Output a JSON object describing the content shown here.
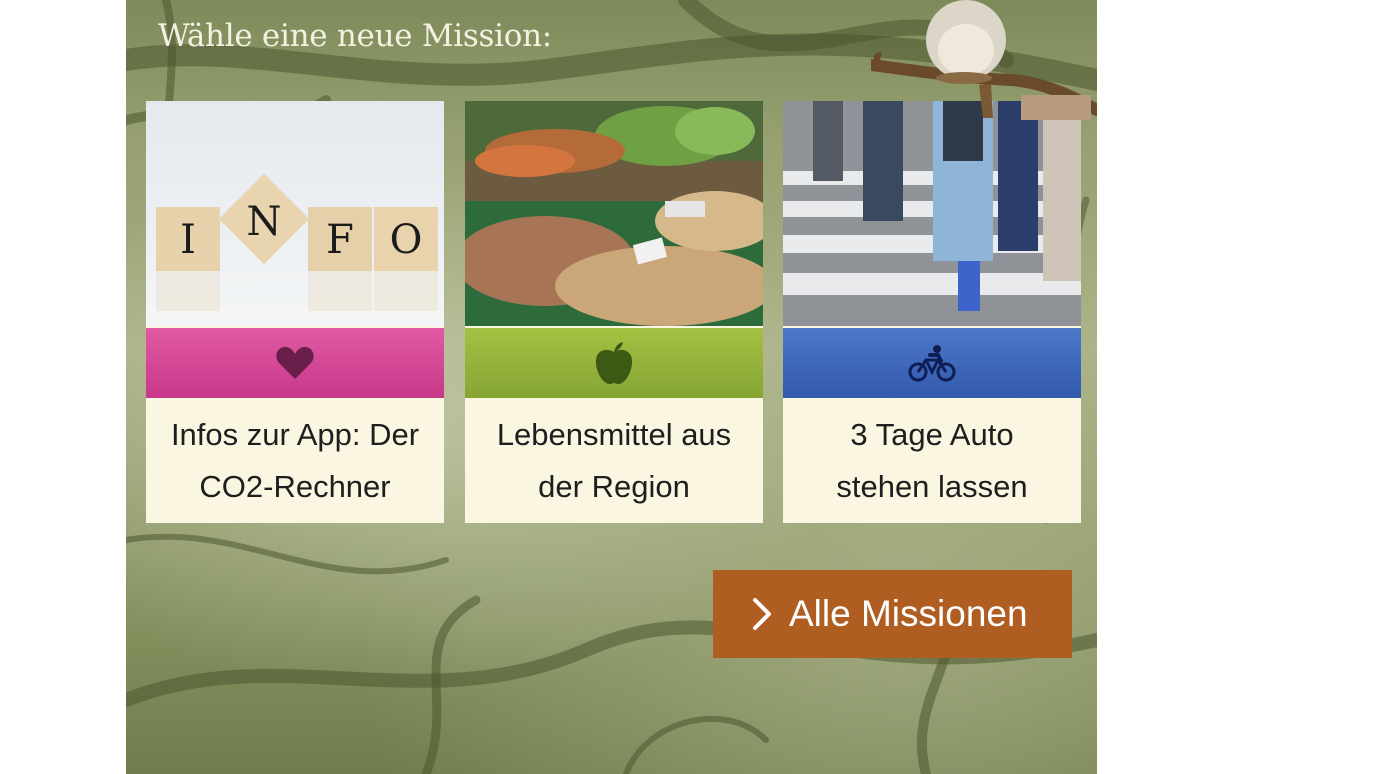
{
  "heading": "Wähle eine neue Mission:",
  "cards": [
    {
      "line1": "Infos zur App: Der",
      "line2": "CO2-Rechner",
      "icon": "heart-icon",
      "accent": "#d6449a",
      "photo_text": [
        "I",
        "N",
        "F",
        "O"
      ]
    },
    {
      "line1": "Lebensmittel aus",
      "line2": "der Region",
      "icon": "apple-icon",
      "accent": "#93b23a"
    },
    {
      "line1": "3 Tage Auto",
      "line2": "stehen lassen",
      "icon": "bicycle-icon",
      "accent": "#3d66b9"
    }
  ],
  "all_missions_button": {
    "label": "Alle Missionen",
    "icon": "chevron-right-icon",
    "color": "#b05d22"
  }
}
